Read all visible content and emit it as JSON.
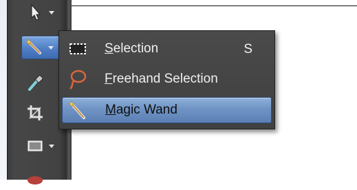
{
  "menu": {
    "items": [
      {
        "label": "Selection",
        "mnemonic": "S",
        "rest": "election",
        "shortcut": "S",
        "icon": "rectangle-selection-icon"
      },
      {
        "label": "Freehand Selection",
        "mnemonic": "F",
        "rest": "reehand Selection",
        "shortcut": "",
        "icon": "lasso-icon"
      },
      {
        "label": "Magic Wand",
        "mnemonic": "M",
        "rest": "agic Wand",
        "shortcut": "",
        "icon": "magic-wand-icon",
        "highlighted": true
      }
    ]
  },
  "toolbar": {
    "tools": [
      {
        "icon": "pointer-icon",
        "has_dropdown": true
      },
      {
        "icon": "magic-wand-icon",
        "has_dropdown": true,
        "active": true
      },
      {
        "icon": "eyedropper-icon",
        "has_dropdown": false
      },
      {
        "icon": "crop-icon",
        "has_dropdown": false
      },
      {
        "icon": "shape-icon",
        "has_dropdown": true
      },
      {
        "icon": "red-eye-icon",
        "has_dropdown": false
      }
    ]
  },
  "colors": {
    "toolbar_bg": "#424242",
    "menu_bg": "#444444",
    "highlight": "#6f93c4",
    "menu_text": "#f0f0f0"
  }
}
